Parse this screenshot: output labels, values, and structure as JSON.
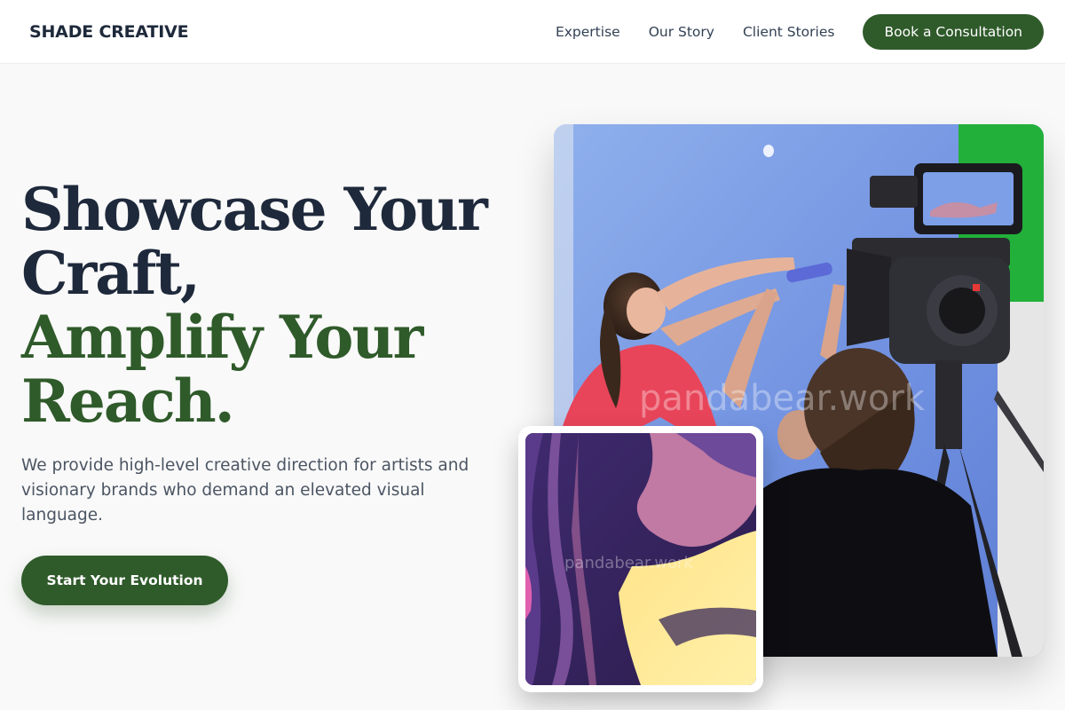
{
  "brand": {
    "name": "SHADE CREATIVE"
  },
  "nav": {
    "links": [
      "Expertise",
      "Our Story",
      "Client Stories"
    ],
    "cta": "Book a Consultation"
  },
  "hero": {
    "title_lines": [
      "Showcase Your",
      "Craft,",
      "Amplify Your",
      "Reach."
    ],
    "description": "We provide high-level creative direction for artists and visionary brands who demand an elevated visual language.",
    "cta": "Start Your Evolution"
  },
  "images": {
    "main_watermark": "pandabear.work",
    "thumb_watermark": "pandabear.work"
  },
  "colors": {
    "brand_green": "#2f5a2a",
    "heading_dark": "#1e293b",
    "body_text": "#4b5563",
    "page_bg": "#f9f9f9"
  }
}
